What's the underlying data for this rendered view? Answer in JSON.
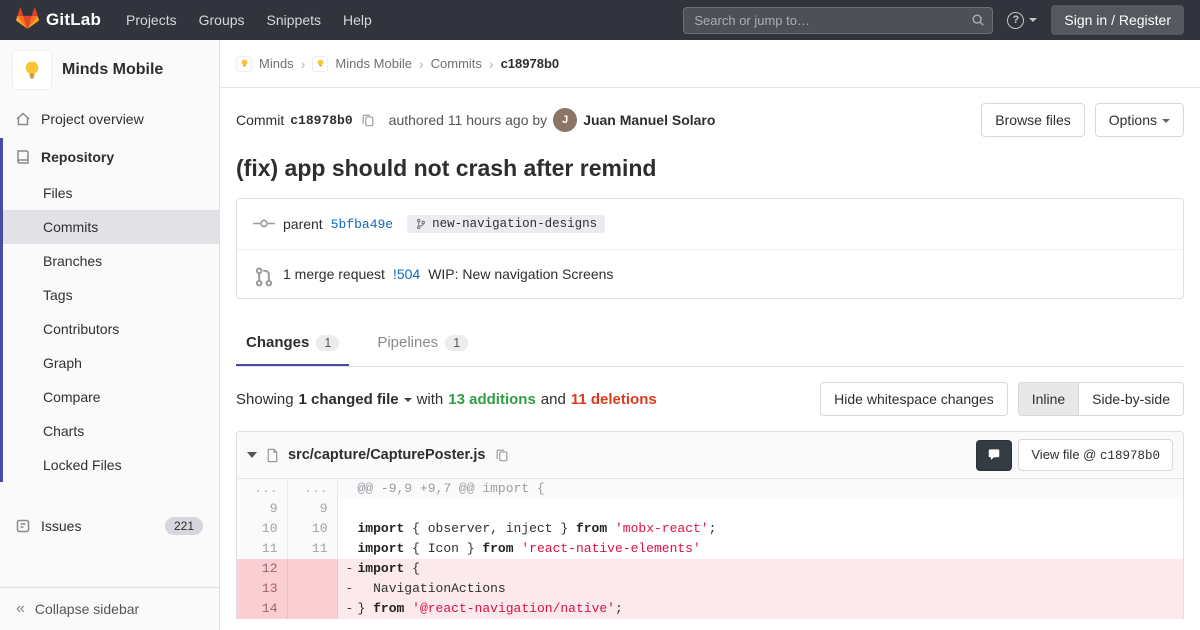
{
  "navbar": {
    "brand": "GitLab",
    "items": [
      "Projects",
      "Groups",
      "Snippets",
      "Help"
    ],
    "search_placeholder": "Search or jump to…",
    "sign_in_label": "Sign in / Register"
  },
  "sidebar": {
    "project_name": "Minds Mobile",
    "overview_label": "Project overview",
    "repository_label": "Repository",
    "repo_items": [
      {
        "label": "Files",
        "active": false
      },
      {
        "label": "Commits",
        "active": true
      },
      {
        "label": "Branches",
        "active": false
      },
      {
        "label": "Tags",
        "active": false
      },
      {
        "label": "Contributors",
        "active": false
      },
      {
        "label": "Graph",
        "active": false
      },
      {
        "label": "Compare",
        "active": false
      },
      {
        "label": "Charts",
        "active": false
      },
      {
        "label": "Locked Files",
        "active": false
      }
    ],
    "issues_label": "Issues",
    "issues_count": "221",
    "collapse_label": "Collapse sidebar"
  },
  "breadcrumb": {
    "crumbs": [
      {
        "label": "Minds",
        "icon": true
      },
      {
        "label": "Minds Mobile",
        "icon": true
      },
      {
        "label": "Commits",
        "icon": false
      }
    ],
    "current": "c18978b0"
  },
  "commit": {
    "label": "Commit",
    "sha": "c18978b0",
    "authored_text": "authored 11 hours ago by",
    "author": "Juan Manuel Solaro",
    "browse_files_label": "Browse files",
    "options_label": "Options",
    "title": "(fix) app should not crash after remind",
    "parent_label": "parent",
    "parent_sha": "5bfba49e",
    "branch_name": "new-navigation-designs",
    "mr_count_text": "1 merge request",
    "mr_ref": "!504",
    "mr_title": "WIP: New navigation Screens"
  },
  "tabs": [
    {
      "label": "Changes",
      "count": "1",
      "active": true
    },
    {
      "label": "Pipelines",
      "count": "1",
      "active": false
    }
  ],
  "summary": {
    "showing_label": "Showing",
    "changed_files_label": "1 changed file",
    "with_label": "with",
    "additions_label": "13 additions",
    "and_label": "and",
    "deletions_label": "11 deletions",
    "hide_whitespace_label": "Hide whitespace changes",
    "inline_label": "Inline",
    "side_by_side_label": "Side-by-side"
  },
  "diff": {
    "file_path": "src/capture/CapturePoster.js",
    "view_file_label": "View file @",
    "view_file_sha": "c18978b0",
    "lines": [
      {
        "type": "hunk",
        "old": "...",
        "new": "...",
        "sign": "",
        "tokens": [
          {
            "t": "g",
            "v": "@@ -9,9 +9,7 @@ import {"
          }
        ]
      },
      {
        "type": "ctx",
        "old": "9",
        "new": "9",
        "sign": "",
        "tokens": []
      },
      {
        "type": "ctx",
        "old": "10",
        "new": "10",
        "sign": "",
        "tokens": [
          {
            "t": "k",
            "v": "import"
          },
          {
            "t": "p",
            "v": " { observer, inject } "
          },
          {
            "t": "k",
            "v": "from"
          },
          {
            "t": "p",
            "v": " "
          },
          {
            "t": "s",
            "v": "'mobx-react'"
          },
          {
            "t": "p",
            "v": ";"
          }
        ]
      },
      {
        "type": "ctx",
        "old": "11",
        "new": "11",
        "sign": "",
        "tokens": [
          {
            "t": "k",
            "v": "import"
          },
          {
            "t": "p",
            "v": " { Icon } "
          },
          {
            "t": "k",
            "v": "from"
          },
          {
            "t": "p",
            "v": " "
          },
          {
            "t": "s",
            "v": "'react-native-elements'"
          }
        ]
      },
      {
        "type": "del",
        "old": "12",
        "new": "",
        "sign": "-",
        "tokens": [
          {
            "t": "k",
            "v": "import"
          },
          {
            "t": "p",
            "v": " {"
          }
        ]
      },
      {
        "type": "del",
        "old": "13",
        "new": "",
        "sign": "-",
        "tokens": [
          {
            "t": "p",
            "v": "  NavigationActions"
          }
        ]
      },
      {
        "type": "del",
        "old": "14",
        "new": "",
        "sign": "-",
        "tokens": [
          {
            "t": "p",
            "v": "} "
          },
          {
            "t": "k",
            "v": "from"
          },
          {
            "t": "p",
            "v": " "
          },
          {
            "t": "s",
            "v": "'@react-navigation/native'"
          },
          {
            "t": "p",
            "v": ";"
          }
        ]
      }
    ]
  },
  "colors": {
    "brand_orange": "#fc6d26",
    "link_blue": "#1068bf",
    "accent_indigo": "#4b4ba3",
    "additions_green": "#2f9e44",
    "deletions_red": "#db3b21"
  }
}
